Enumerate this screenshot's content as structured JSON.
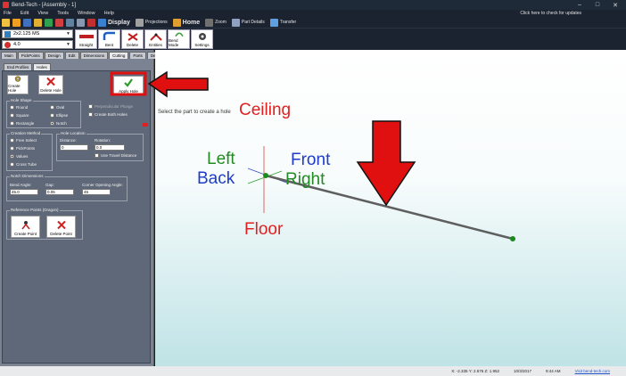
{
  "window": {
    "title": "Bend-Tech - [Assembly - 1]",
    "min": "–",
    "max": "□",
    "close": "✕"
  },
  "menu": {
    "items": [
      "File",
      "Edit",
      "View",
      "Tools",
      "Window",
      "Help"
    ],
    "update_notice": "Click here to check for updates"
  },
  "toolbar": {
    "display": "Display",
    "projections": "Projections",
    "home": "Home",
    "zoom": "Zoom",
    "part_details": "Part Details",
    "transfer": "Transfer"
  },
  "material": {
    "tube": "2x2.125 MS",
    "radius": "4.0"
  },
  "actions": {
    "straight": "Straight",
    "bent": "Bent",
    "delete": "Delete",
    "entities": "Entities",
    "bend_mode": "Bend Mode",
    "settings": "Settings"
  },
  "tabs_top": [
    "Main",
    "PickPoints",
    "Design",
    "Edit",
    "Dimensions",
    "Cutting",
    "Parts",
    "Details"
  ],
  "tabs_sub": [
    "End Profiles",
    "Holes"
  ],
  "hole_buttons": {
    "create": "Create Hole",
    "delete": "Delete Hole",
    "apply": "Apply Hole"
  },
  "hole_shape": {
    "label": "Hole Shape",
    "options": [
      "Round",
      "Square",
      "Rectangle",
      "Oval",
      "Ellipse",
      "Notch"
    ],
    "selected": "Notch",
    "perpendicular": "Perpendicular Plunge",
    "create_both": "Create Both Holes"
  },
  "creation_method": {
    "label": "Creation Method",
    "options": [
      "Free Select",
      "PickPoints",
      "Values",
      "Cross Tube"
    ],
    "selected": "Values"
  },
  "hole_location": {
    "label": "Hole Location",
    "distance_label": "Distance:",
    "distance": "0",
    "rotation_label": "Rotation:",
    "rotation": "0.0",
    "travel": "Use Travel Distance"
  },
  "notch_dims": {
    "label": "Notch Dimensions",
    "bend_angle_label": "Bend Angle:",
    "bend_angle": "45.0",
    "gap_label": "Gap:",
    "gap": "0.05",
    "corner_label": "Corner Opening Angle:",
    "corner": "45"
  },
  "reference_points": {
    "label": "Reference Points (Dragon)",
    "create": "Create Point",
    "delete": "Delete Point"
  },
  "viewport": {
    "hint": "Select the part to create a hole",
    "ceiling": "Ceiling",
    "floor": "Floor",
    "left": "Left",
    "back": "Back",
    "front": "Front",
    "right": "Right"
  },
  "colors": {
    "red_label": "#e02020",
    "green_label": "#228b22",
    "blue_label": "#1e3cc8",
    "arrow": "#e01010"
  },
  "status": {
    "coords": "X: -2.335  Y: 2.676  Z: 1.952",
    "date": "10/3/2017",
    "time": "9:44 AM",
    "site": "Visit bend-tech.com"
  }
}
